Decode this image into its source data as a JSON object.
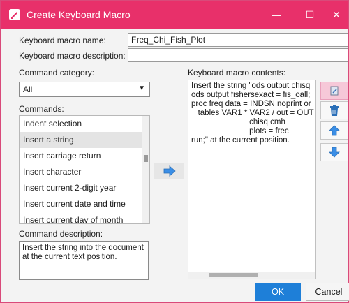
{
  "window": {
    "title": "Create Keyboard Macro",
    "controls": {
      "minimize": "—",
      "maximize": "☐",
      "close": "✕"
    }
  },
  "form": {
    "name_label": "Keyboard macro name:",
    "name_value": "Freq_Chi_Fish_Plot",
    "description_label": "Keyboard macro description:",
    "description_value": ""
  },
  "category": {
    "label": "Command category:",
    "selected": "All"
  },
  "commands": {
    "label": "Commands:",
    "items": [
      "Indent selection",
      "Insert a string",
      "Insert carriage return",
      "Insert character",
      "Insert current 2-digit year",
      "Insert current date and time",
      "Insert current day of month"
    ],
    "selected_index": 1
  },
  "command_description": {
    "label": "Command description:",
    "text": "Insert the string into the document at the current text position."
  },
  "macro_contents": {
    "label": "Keyboard macro contents:",
    "text": "Insert the string \"ods output chisq\nods output fishersexact = fis_oall;\nproc freq data = INDSN noprint or\n   tables VAR1 * VAR2 / out = OUT\n                          chisq cmh\n                          plots = frec\nrun;\" at the current position."
  },
  "side_buttons": [
    {
      "icon": "edit-icon"
    },
    {
      "icon": "trash-icon"
    },
    {
      "icon": "move-up-icon"
    },
    {
      "icon": "move-down-icon"
    }
  ],
  "buttons": {
    "ok": "OK",
    "cancel": "Cancel"
  },
  "colors": {
    "accent": "#e8306a",
    "primary_button": "#1e7fd8",
    "selection": "#e4e4e4"
  }
}
